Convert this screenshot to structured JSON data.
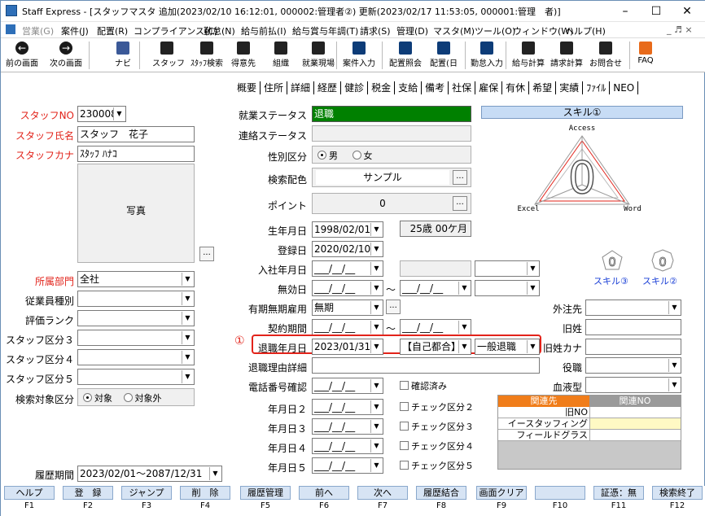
{
  "window": {
    "title": "Staff Express - [スタッフマスタ 追加(2023/02/10 16:12:01, 000002:管理者②) 更新(2023/02/17 11:53:05, 000001:管理　者)]",
    "min": "–",
    "max": "☐",
    "close": "✕"
  },
  "menu": [
    "営業(G)",
    "案件(J)",
    "配置(R)",
    "コンプライアンス(C)",
    "勤怠(N)",
    "給与前払(I)",
    "給与賞与年調(T)",
    "請求(S)",
    "管理(D)",
    "マスタ(M)",
    "ツール(O)",
    "ウィンドウ(W)",
    "ヘルプ(H)"
  ],
  "menu_right": "_ ♬ ×",
  "toolbar": [
    {
      "label": "前の画面",
      "icon": "back-arrow-icon"
    },
    {
      "label": "次の画面",
      "icon": "forward-arrow-icon"
    },
    {
      "label": "ナビ",
      "icon": "navi-icon"
    },
    {
      "label": "スタッフ",
      "icon": "staff-icon"
    },
    {
      "label": "ｽﾀｯﾌ検索",
      "icon": "staff-search-icon"
    },
    {
      "label": "得意先",
      "icon": "client-icon"
    },
    {
      "label": "組織",
      "icon": "org-icon"
    },
    {
      "label": "就業現場",
      "icon": "site-icon"
    },
    {
      "label": "案件入力",
      "icon": "job-input-icon"
    },
    {
      "label": "配置照会",
      "icon": "assign-inquiry-icon"
    },
    {
      "label": "配置(日",
      "icon": "assign-daily-icon"
    },
    {
      "label": "勤怠入力",
      "icon": "attendance-icon"
    },
    {
      "label": "給与計算",
      "icon": "payroll-icon"
    },
    {
      "label": "請求計算",
      "icon": "billing-icon"
    },
    {
      "label": "お問合せ",
      "icon": "inquiry-icon"
    },
    {
      "label": "FAQ",
      "icon": "faq-icon"
    }
  ],
  "left": {
    "staff_no_label": "スタッフNO",
    "staff_no": "230008",
    "name_label": "スタッフ氏名",
    "name": "スタッフ　花子",
    "kana_label": "スタッフカナ",
    "kana": "ｽﾀｯﾌ ﾊﾅｺ",
    "photo_label": "写真",
    "photo_btn": "...",
    "dept_label": "所属部門",
    "dept": "全社",
    "emp_type_label": "従業員種別",
    "eval_label": "評価ランク",
    "cat3_label": "スタッフ区分３",
    "cat4_label": "スタッフ区分４",
    "cat5_label": "スタッフ区分５",
    "search_label": "検索対象区分",
    "search_on": "対象",
    "search_off": "対象外",
    "history_label": "履歴期間",
    "history": "2023/02/01～2087/12/31"
  },
  "tabs": [
    "概要",
    "住所",
    "詳細",
    "経歴",
    "健診",
    "税金",
    "支給",
    "備考",
    "社保",
    "雇保",
    "有休",
    "希望",
    "実績",
    "ﾌｧｲﾙ",
    "NEO"
  ],
  "main": {
    "work_status_label": "就業ステータス",
    "work_status": "退職",
    "contact_status_label": "連絡ステータス",
    "gender_label": "性別区分",
    "male": "男",
    "female": "女",
    "color_label": "検索配色",
    "color_sample": "サンプル",
    "btn": "...",
    "point_label": "ポイント",
    "point": "0",
    "birth_label": "生年月日",
    "birth": "1998/02/01",
    "age": "25歳 00ケ月",
    "reg_label": "登録日",
    "reg": "2020/02/10",
    "join_label": "入社年月日",
    "blank_date": "___/__/__",
    "invalid_label": "無効日",
    "tilde": "～",
    "term_label": "有期無期雇用",
    "term": "無期",
    "contract_label": "契約期間",
    "retire_label": "退職年月日",
    "retire": "2023/01/31",
    "retire_reason": "【自己都合】",
    "retire_type": "一般退職",
    "marker": "①",
    "retire_detail_label": "退職理由詳細",
    "phone_label": "電話番号確認",
    "phone_chk": "確認済み",
    "date2_label": "年月日２",
    "chk2": "チェック区分２",
    "date3_label": "年月日３",
    "chk3": "チェック区分３",
    "date4_label": "年月日４",
    "chk4": "チェック区分４",
    "date5_label": "年月日５",
    "chk5": "チェック区分５"
  },
  "right": {
    "skill_title": "スキル①",
    "access": "Access",
    "excel": "Excel",
    "word": "Word",
    "skill_val": "0",
    "skill3": "スキル③",
    "skill2": "スキル②",
    "small_val": "0",
    "outsource_label": "外注先",
    "old_name_label": "旧姓",
    "old_kana_label": "旧姓カナ",
    "post_label": "役職",
    "blood_label": "血液型",
    "rel_header1": "関連先",
    "rel_header2": "関連NO",
    "rel_rows": [
      [
        "旧NO",
        ""
      ],
      [
        "イースタッフィング",
        ""
      ],
      [
        "フィールドグラス",
        ""
      ]
    ]
  },
  "fkeys": [
    {
      "label": "ヘルプ",
      "key": "F1"
    },
    {
      "label": "登　録",
      "key": "F2"
    },
    {
      "label": "ジャンプ",
      "key": "F3"
    },
    {
      "label": "削　除",
      "key": "F4"
    },
    {
      "label": "履歴管理",
      "key": "F5"
    },
    {
      "label": "前へ",
      "key": "F6"
    },
    {
      "label": "次へ",
      "key": "F7"
    },
    {
      "label": "履歴結合",
      "key": "F8"
    },
    {
      "label": "画面クリア",
      "key": "F9"
    },
    {
      "label": "",
      "key": "F10"
    },
    {
      "label": "証憑：無",
      "key": "F11"
    },
    {
      "label": "検索終了",
      "key": "F12"
    }
  ]
}
